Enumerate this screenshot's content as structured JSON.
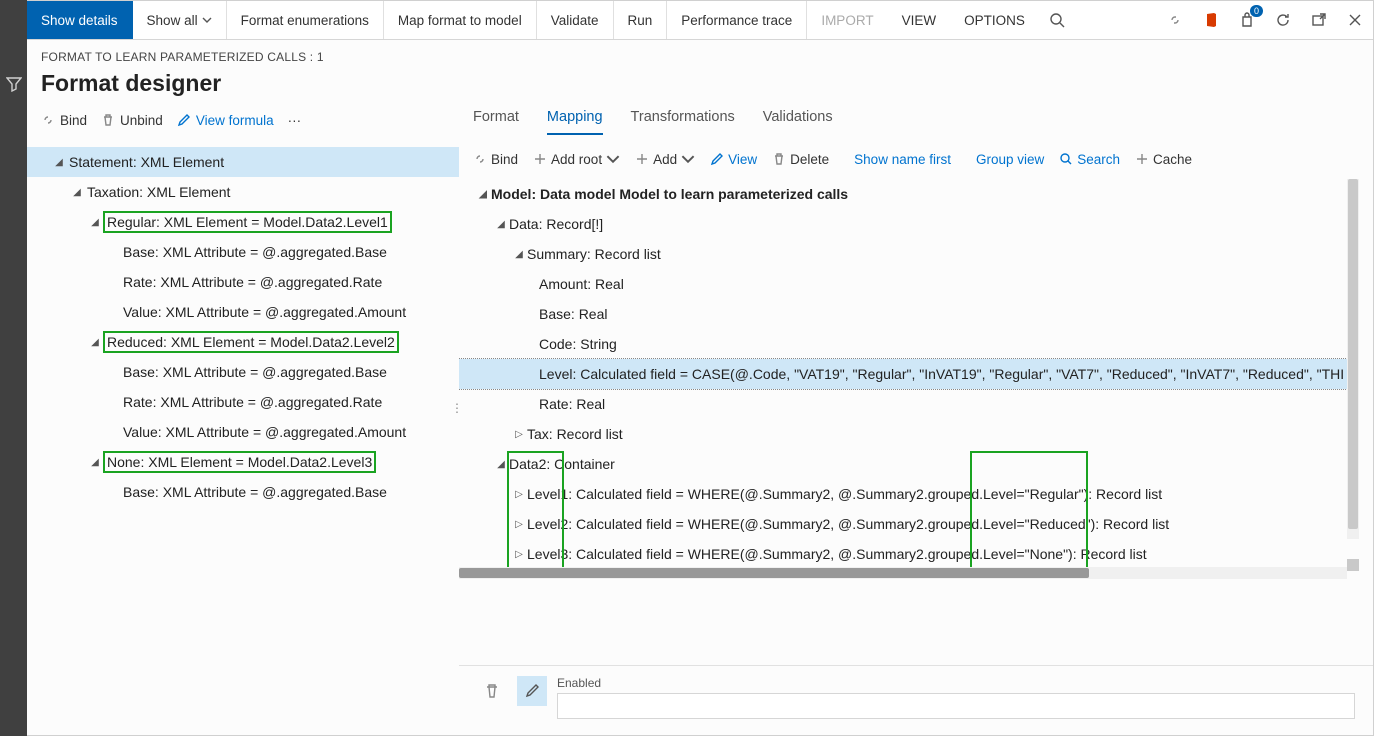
{
  "commandbar": {
    "show_details": "Show details",
    "show_all": "Show all",
    "format_enum": "Format enumerations",
    "map_model": "Map format to model",
    "validate": "Validate",
    "run": "Run",
    "perf_trace": "Performance trace",
    "import": "IMPORT",
    "view": "VIEW",
    "options": "OPTIONS",
    "badge_count": "0"
  },
  "header": {
    "breadcrumb": "FORMAT TO LEARN PARAMETERIZED CALLS : 1",
    "title": "Format designer"
  },
  "left_toolbar": {
    "bind": "Bind",
    "unbind": "Unbind",
    "view_formula": "View formula",
    "more": "···"
  },
  "left_tree": {
    "statement": "Statement: XML Element",
    "taxation": "Taxation: XML Element",
    "regular": "Regular: XML Element = Model.Data2.Level1",
    "base": "Base: XML Attribute = @.aggregated.Base",
    "rate": "Rate: XML Attribute = @.aggregated.Rate",
    "value": "Value: XML Attribute = @.aggregated.Amount",
    "reduced": "Reduced: XML Element = Model.Data2.Level2",
    "none": "None: XML Element = Model.Data2.Level3"
  },
  "right_tabs": {
    "format": "Format",
    "mapping": "Mapping",
    "transformations": "Transformations",
    "validations": "Validations"
  },
  "right_toolbar": {
    "bind": "Bind",
    "add_root": "Add root",
    "add": "Add",
    "view": "View",
    "delete": "Delete",
    "show_name_first": "Show name first",
    "group_view": "Group view",
    "search": "Search",
    "cache": "Cache"
  },
  "right_tree": {
    "model": "Model: Data model Model to learn parameterized calls",
    "data": "Data: Record[!]",
    "summary": "Summary: Record list",
    "amount": "Amount: Real",
    "base": "Base: Real",
    "code": "Code: String",
    "level": "Level: Calculated field = CASE(@.Code, \"VAT19\", \"Regular\", \"InVAT19\", \"Regular\", \"VAT7\", \"Reduced\", \"InVAT7\", \"Reduced\", \"THI",
    "rate": "Rate: Real",
    "tax": "Tax: Record list",
    "data2": "Data2: Container",
    "level1": "Level1: Calculated field = WHERE(@.Summary2, @.Summary2.grouped.Level=\"Regular\"): Record list",
    "level2": "Level2: Calculated field = WHERE(@.Summary2, @.Summary2.grouped.Level=\"Reduced\"): Record list",
    "level3": "Level3: Calculated field = WHERE(@.Summary2, @.Summary2.grouped.Level=\"None\"): Record list"
  },
  "bottom": {
    "label": "Enabled",
    "value": ""
  }
}
